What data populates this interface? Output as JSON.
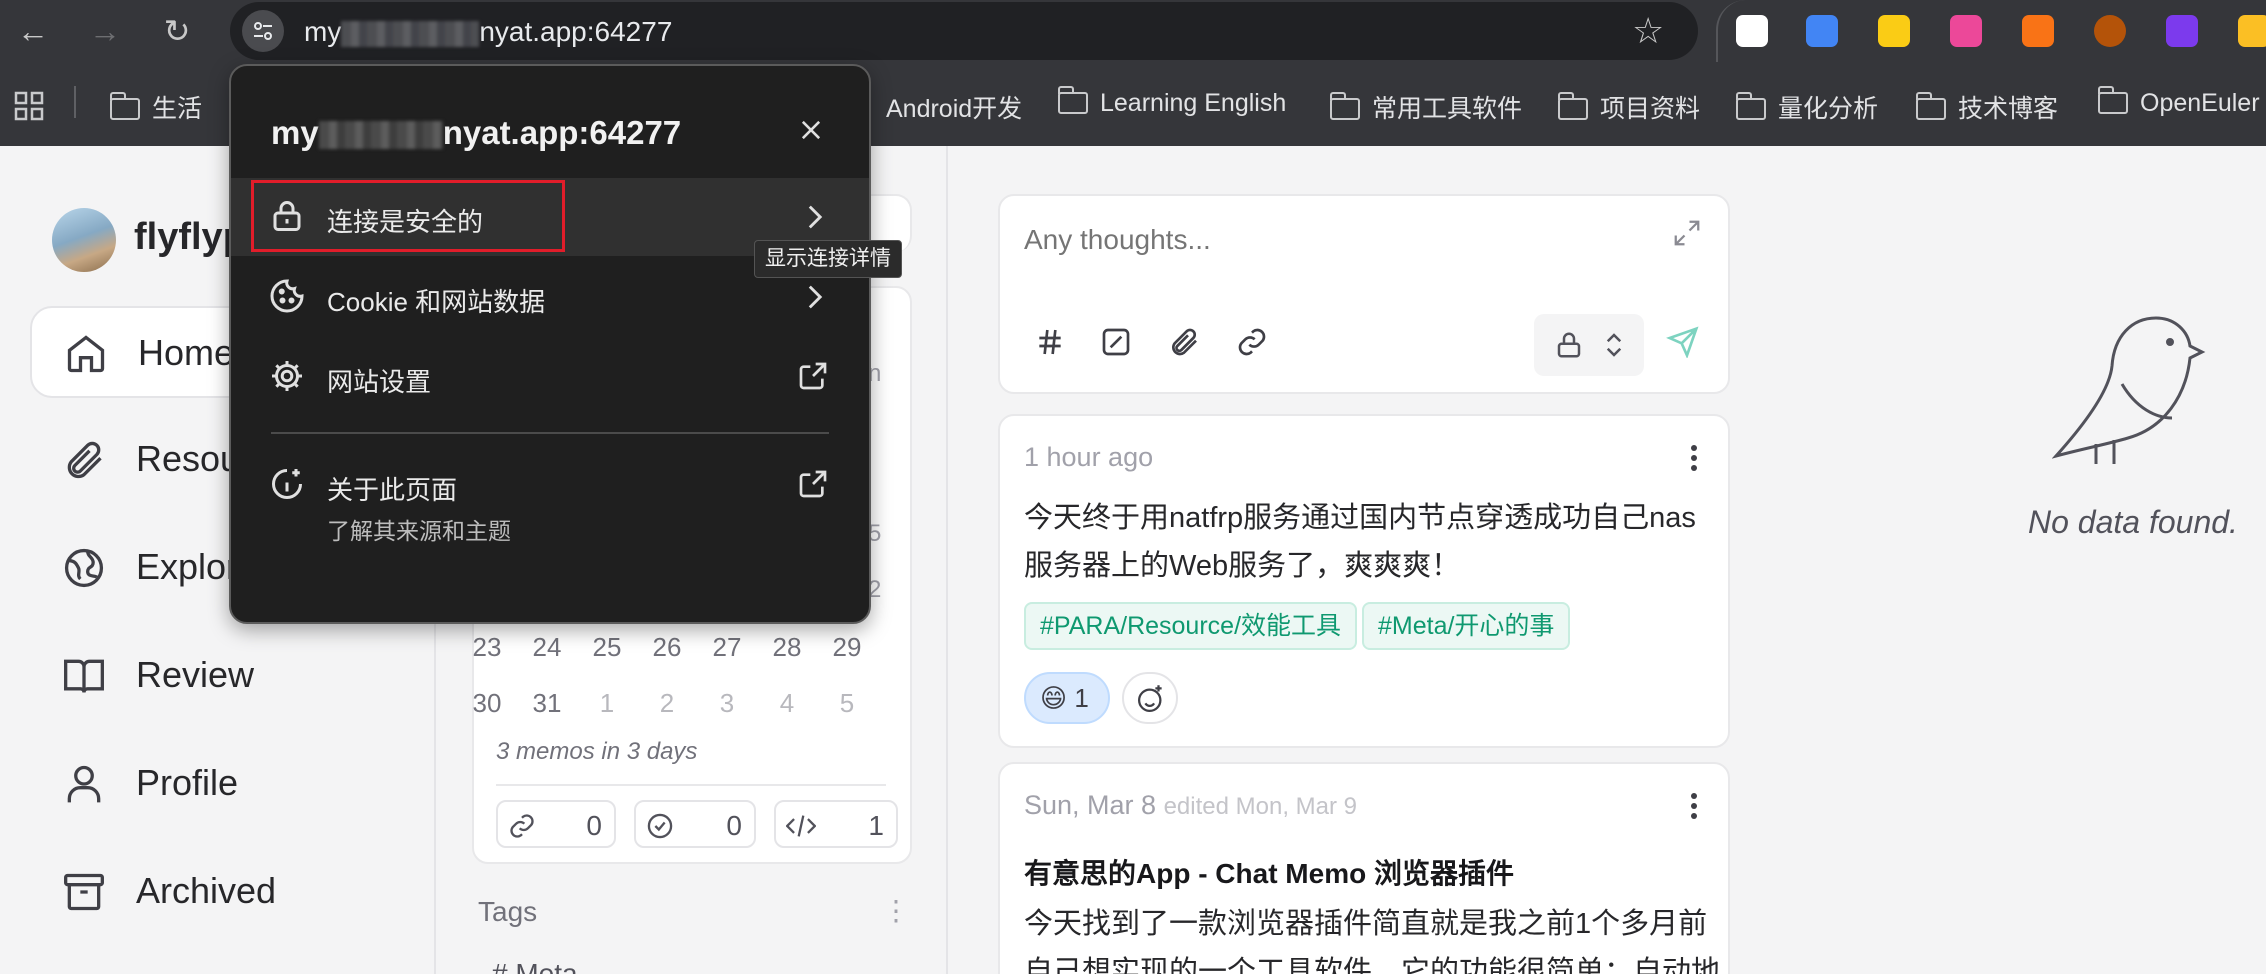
{
  "browser": {
    "url_prefix": "my",
    "url_suffix": "nyat.app:64277",
    "bookmarks": [
      {
        "label": "生活"
      },
      {
        "label": "Android开发"
      },
      {
        "label": "Learning English"
      },
      {
        "label": "常用工具软件"
      },
      {
        "label": "项目资料"
      },
      {
        "label": "量化分析"
      },
      {
        "label": "技术博客"
      },
      {
        "label": "OpenEuler"
      }
    ],
    "extensions": [
      {
        "name": "feishu-extension-icon",
        "color": "#ffffff"
      },
      {
        "name": "google-translate-icon",
        "color": "#4285f4"
      },
      {
        "name": "sticky-notes-icon",
        "color": "#facc15"
      },
      {
        "name": "translate-extension-icon",
        "color": "#ec4899"
      },
      {
        "name": "screenshot-extension-icon",
        "color": "#f97316"
      },
      {
        "name": "cookie-extension-icon",
        "color": "#b45309"
      },
      {
        "name": "puzzle-extension-icon",
        "color": "#7c3aed"
      }
    ]
  },
  "popup": {
    "host_prefix": "my",
    "host_suffix": "nyat.app:64277",
    "connection_label": "连接是安全的",
    "cookie_label": "Cookie 和网站数据",
    "site_settings_label": "网站设置",
    "about_label": "关于此页面",
    "about_sublabel": "了解其来源和主题",
    "tooltip": "显示连接详情"
  },
  "sidebar": {
    "username": "flyflyp",
    "items": [
      {
        "label": "Home",
        "icon": "home-icon",
        "active": true
      },
      {
        "label": "Resou",
        "icon": "paperclip-icon"
      },
      {
        "label": "Explor",
        "icon": "globe-icon"
      },
      {
        "label": "Review",
        "icon": "book-open-icon"
      },
      {
        "label": "Profile",
        "icon": "user-icon"
      },
      {
        "label": "Archived",
        "icon": "archive-icon"
      }
    ]
  },
  "calendar": {
    "partial_n": "n",
    "partial_5": "5",
    "partial_2": "2",
    "week5": [
      "23",
      "24",
      "25",
      "26",
      "27",
      "28",
      "29"
    ],
    "week6": [
      "30",
      "31",
      "1",
      "2",
      "3",
      "4",
      "5"
    ],
    "memo_count": "3 memos in 3 days",
    "stats": {
      "links": "0",
      "todos": "0",
      "code": "1"
    },
    "tags_title": "Tags",
    "tag_partial": "# Meta"
  },
  "editor": {
    "placeholder": "Any thoughts..."
  },
  "memos": [
    {
      "time": "1 hour ago",
      "line1": "今天终于用natfrp服务通过国内节点穿透成功自己nas",
      "line2": "服务器上的Web服务了，爽爽爽！",
      "tags": [
        "#PARA/Resource/效能工具",
        "#Meta/开心的事"
      ],
      "reaction_emoji": "😄",
      "reaction_count": "1"
    },
    {
      "time": "Sun, Mar 8",
      "edited": "edited Mon, Mar 9",
      "title": "有意思的App - Chat Memo 浏览器插件",
      "line1": "今天找到了一款浏览器插件简直就是我之前1个多月前",
      "line2": "自己想实现的一个工具软件，它的功能很简单：自动地"
    }
  ],
  "empty": {
    "text": "No data found."
  }
}
